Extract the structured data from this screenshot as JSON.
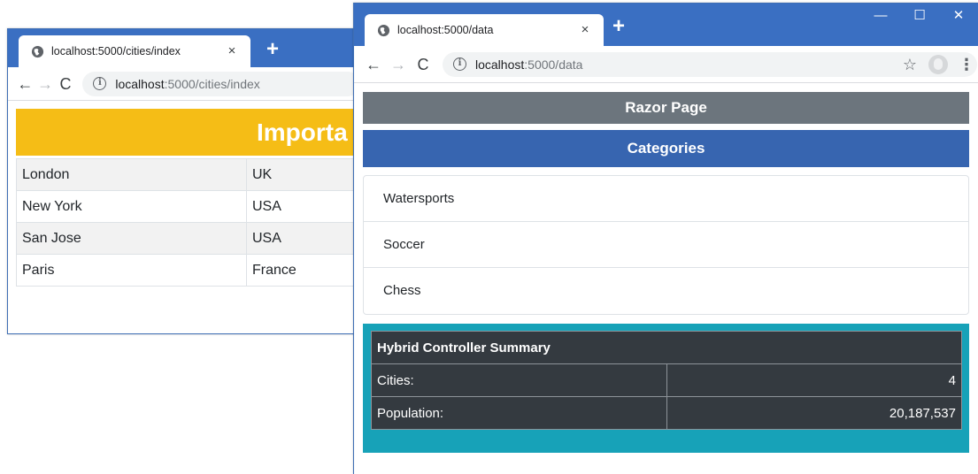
{
  "back_window": {
    "tab_title": "localhost:5000/cities/index",
    "tab_close": "×",
    "new_tab": "+",
    "url_host": "localhost",
    "url_path": ":5000/cities/index",
    "banner": "Importa",
    "cities": [
      {
        "city": "London",
        "country": "UK"
      },
      {
        "city": "New York",
        "country": "USA"
      },
      {
        "city": "San Jose",
        "country": "USA"
      },
      {
        "city": "Paris",
        "country": "France"
      }
    ]
  },
  "front_window": {
    "tab_title": "localhost:5000/data",
    "tab_close": "×",
    "new_tab": "+",
    "url_host": "localhost",
    "url_path": ":5000/data",
    "razor_heading": "Razor Page",
    "categories_heading": "Categories",
    "categories": [
      "Watersports",
      "Soccer",
      "Chess"
    ],
    "summary": {
      "title": "Hybrid Controller Summary",
      "rows": [
        {
          "label": "Cities:",
          "value": "4"
        },
        {
          "label": "Population:",
          "value": "20,187,537"
        }
      ]
    }
  },
  "icons": {
    "back": "←",
    "forward": "→",
    "reload": "C",
    "info": "i",
    "star": "☆",
    "menu": "⋮",
    "minimize": "—",
    "maximize": "☐",
    "close": "✕"
  },
  "colors": {
    "tabstrip": "#3a6fc2",
    "banner": "#f5bd16",
    "razor_bar": "#6c757d",
    "categories_bar": "#3765b0",
    "summary_bg": "#17a2b8",
    "summary_table": "#343a40"
  }
}
